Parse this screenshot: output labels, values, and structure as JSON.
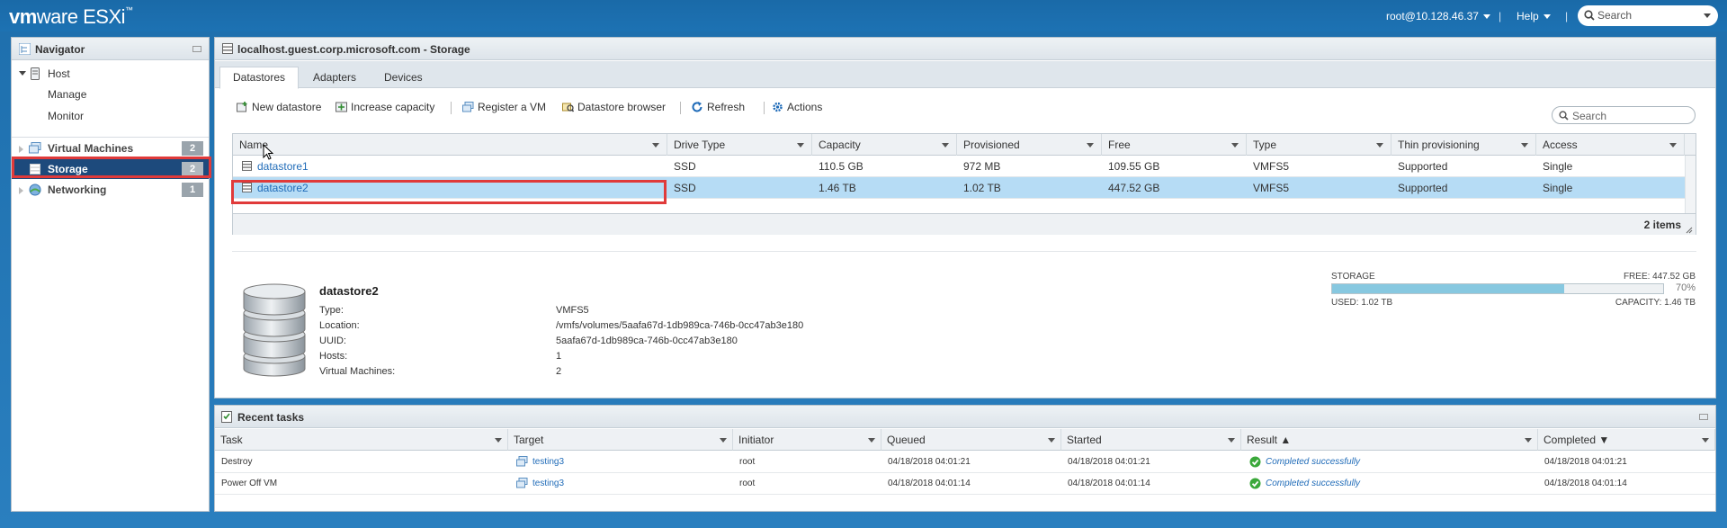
{
  "brand": {
    "name": "vm",
    "name2": "ware",
    "product": "ESXi"
  },
  "topbar": {
    "user": "root@10.128.46.37",
    "sep": "|",
    "help": "Help",
    "search_placeholder": "Search"
  },
  "navigator": {
    "title": "Navigator",
    "host": "Host",
    "manage": "Manage",
    "monitor": "Monitor",
    "vms": {
      "label": "Virtual Machines",
      "count": "2"
    },
    "storage": {
      "label": "Storage",
      "count": "2"
    },
    "networking": {
      "label": "Networking",
      "count": "1"
    }
  },
  "main": {
    "title": "localhost.guest.corp.microsoft.com - Storage",
    "tabs": [
      "Datastores",
      "Adapters",
      "Devices"
    ],
    "toolbar": {
      "new_datastore": "New datastore",
      "increase_capacity": "Increase capacity",
      "register_vm": "Register a VM",
      "datastore_browser": "Datastore browser",
      "refresh": "Refresh",
      "actions": "Actions"
    },
    "search_placeholder": "Search",
    "columns": [
      "Name",
      "Drive Type",
      "Capacity",
      "Provisioned",
      "Free",
      "Type",
      "Thin provisioning",
      "Access"
    ],
    "rows": [
      [
        "datastore1",
        "SSD",
        "110.5 GB",
        "972 MB",
        "109.55 GB",
        "VMFS5",
        "Supported",
        "Single"
      ],
      [
        "datastore2",
        "SSD",
        "1.46 TB",
        "1.02 TB",
        "447.52 GB",
        "VMFS5",
        "Supported",
        "Single"
      ]
    ],
    "items_count": "2 items"
  },
  "details": {
    "name": "datastore2",
    "fields": [
      {
        "k": "Type:",
        "v": "VMFS5"
      },
      {
        "k": "Location:",
        "v": "/vmfs/volumes/5aafa67d-1db989ca-746b-0cc47ab3e180"
      },
      {
        "k": "UUID:",
        "v": "5aafa67d-1db989ca-746b-0cc47ab3e180"
      },
      {
        "k": "Hosts:",
        "v": "1"
      },
      {
        "k": "Virtual Machines:",
        "v": "2"
      }
    ],
    "storage": {
      "label": "STORAGE",
      "free": "FREE: 447.52 GB",
      "percent": "70%",
      "used_fraction": 0.7,
      "used": "USED: 1.02 TB",
      "capacity": "CAPACITY: 1.46 TB"
    }
  },
  "tasks": {
    "title": "Recent tasks",
    "columns": [
      "Task",
      "Target",
      "Initiator",
      "Queued",
      "Started",
      "Result ▲",
      "Completed ▼"
    ],
    "rows": [
      [
        "Destroy",
        "testing3",
        "root",
        "04/18/2018 04:01:21",
        "04/18/2018 04:01:21",
        "Completed successfully",
        "04/18/2018 04:01:21"
      ],
      [
        "Power Off VM",
        "testing3",
        "root",
        "04/18/2018 04:01:14",
        "04/18/2018 04:01:14",
        "Completed successfully",
        "04/18/2018 04:01:14"
      ]
    ]
  },
  "colors": {
    "accent": "#1d72b3",
    "selection": "#b6dcf5",
    "nav_selected": "#1d4a7c",
    "highlight_box": "#e03a3a",
    "storage_fill": "#87c8e0"
  }
}
